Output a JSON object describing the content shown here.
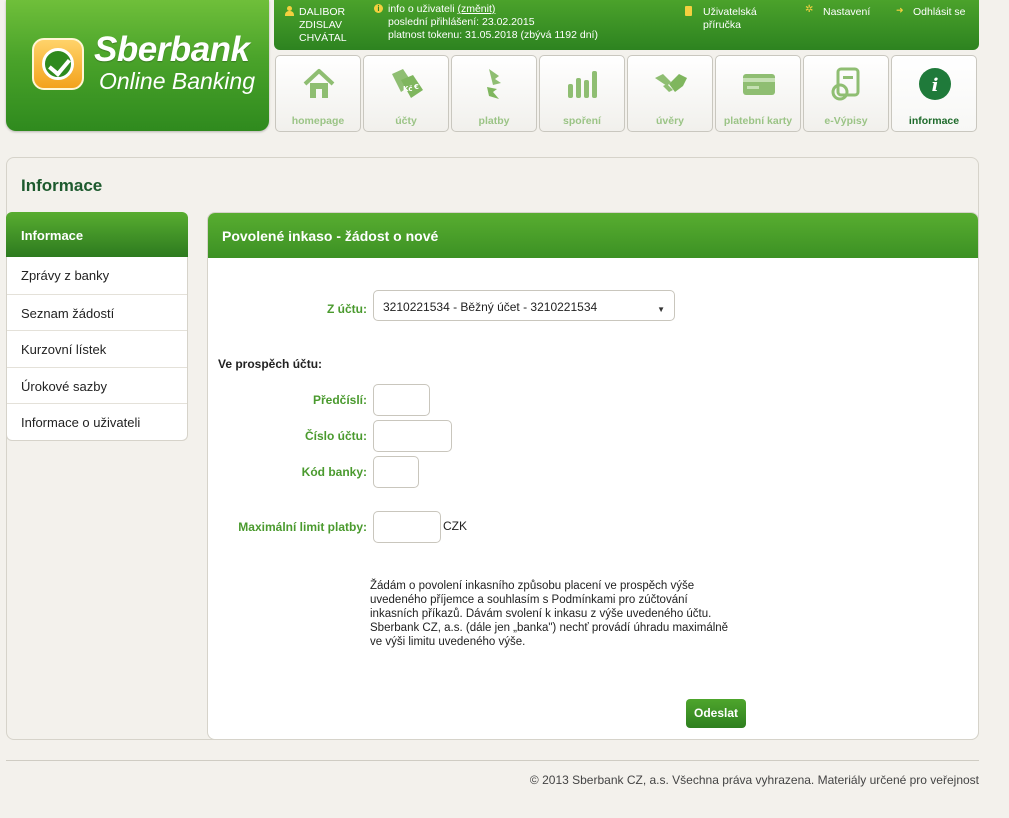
{
  "brand": {
    "name": "Sberbank",
    "product": "Online Banking"
  },
  "topbar": {
    "user_first": "DALIBOR",
    "user_middle": "ZDISLAV",
    "user_last": "CHVÁTAL",
    "info_prefix": "info o uživateli",
    "info_change": "(změnit)",
    "last_login": "poslední přihlášení: 23.02.2015",
    "token_validity": "platnost tokenu: 31.05.2018 (zbývá 1192 dní)",
    "manual_line1": "Uživatelská",
    "manual_line2": "příručka",
    "settings": "Nastavení",
    "logout": "Odhlásit se"
  },
  "nav": {
    "tabs": [
      {
        "label": "homepage",
        "icon": "home-icon"
      },
      {
        "label": "účty",
        "icon": "tags-icon"
      },
      {
        "label": "platby",
        "icon": "payments-icon"
      },
      {
        "label": "spoření",
        "icon": "savings-icon"
      },
      {
        "label": "úvěry",
        "icon": "handshake-icon"
      },
      {
        "label": "platební karty",
        "icon": "card-icon"
      },
      {
        "label": "e-Výpisy",
        "icon": "statement-icon"
      },
      {
        "label": "informace",
        "icon": "info-icon",
        "active": true
      }
    ]
  },
  "page": {
    "title": "Informace"
  },
  "sidebar": {
    "active": "Informace",
    "items": [
      {
        "label": "Zprávy z banky"
      },
      {
        "label": "Seznam žádostí"
      },
      {
        "label": "Kurzovní lístek"
      },
      {
        "label": "Úrokové sazby"
      },
      {
        "label": "Informace o uživateli"
      }
    ]
  },
  "form": {
    "header": "Povolené inkaso - žádost o nové",
    "from_account_label": "Z účtu:",
    "from_account_value": "3210221534 - Běžný účet - 3210221534",
    "beneficiary_label": "Ve prospěch účtu:",
    "prefix_label": "Předčíslí:",
    "account_label": "Číslo účtu:",
    "bank_code_label": "Kód banky:",
    "max_limit_label": "Maximální limit platby:",
    "currency": "CZK",
    "consent": "Žádám o povolení inkasního způsobu placení ve prospěch výše uvedeného příjemce a souhlasím s Podmínkami pro zúčtování inkasních příkazů. Dávám svolení k inkasu z výše uvedeného účtu. Sberbank CZ, a.s. (dále jen „banka\") nechť provádí úhradu maximálně ve výši limitu uvedeného výše.",
    "submit": "Odeslat"
  },
  "footer": {
    "text": "© 2013 Sberbank CZ, a.s. Všechna práva vyhrazena. Materiály určené pro veřejnost"
  },
  "colors": {
    "brand_green": "#3c9124",
    "label_green": "#4a9a2e",
    "dark_green": "#1d5a2e",
    "accent_yellow": "#f4d03f"
  }
}
